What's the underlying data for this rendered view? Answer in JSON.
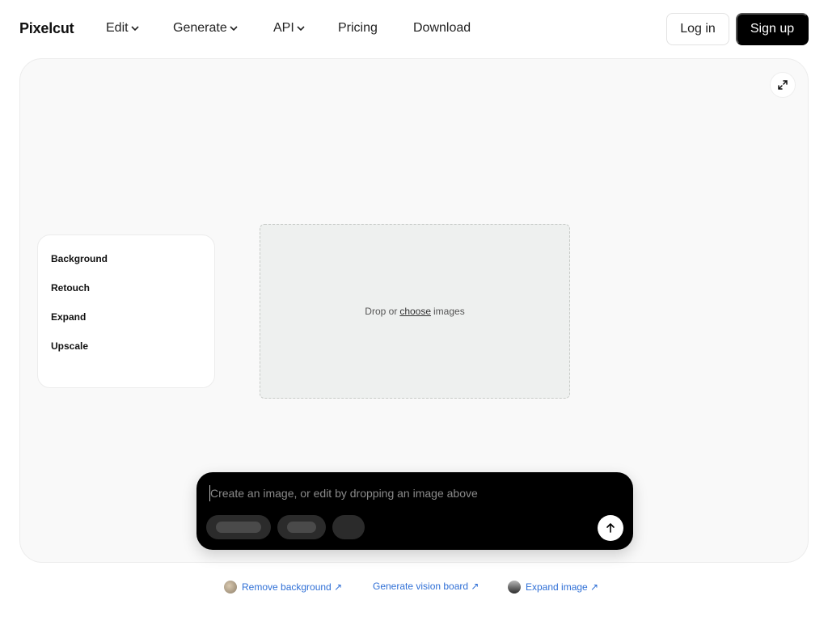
{
  "header": {
    "logo": "Pixelcut",
    "nav": [
      {
        "label": "Edit",
        "has_dropdown": true
      },
      {
        "label": "Generate",
        "has_dropdown": true
      },
      {
        "label": "API",
        "has_dropdown": true
      },
      {
        "label": "Pricing",
        "has_dropdown": false
      },
      {
        "label": "Download",
        "has_dropdown": false
      }
    ],
    "login_label": "Log in",
    "signup_label": "Sign up"
  },
  "tools": {
    "items": [
      "Background",
      "Retouch",
      "Expand",
      "Upscale"
    ]
  },
  "dropzone": {
    "prefix": "Drop or",
    "link": "choose",
    "suffix": "images"
  },
  "prompt": {
    "placeholder": "Create an image, or edit by dropping an image above",
    "value": ""
  },
  "links": [
    {
      "label": "Remove background ↗"
    },
    {
      "label": "Generate vision board ↗"
    },
    {
      "label": "Expand image ↗"
    }
  ],
  "icons": {
    "expand": "expand-arrows-icon",
    "send": "arrow-up-icon",
    "chevron": "chevron-down-icon"
  },
  "colors": {
    "accent": "#000000",
    "link": "#2f6fd6",
    "canvas_bg": "#f9f9f9",
    "dropzone_bg": "#eef0ef"
  }
}
